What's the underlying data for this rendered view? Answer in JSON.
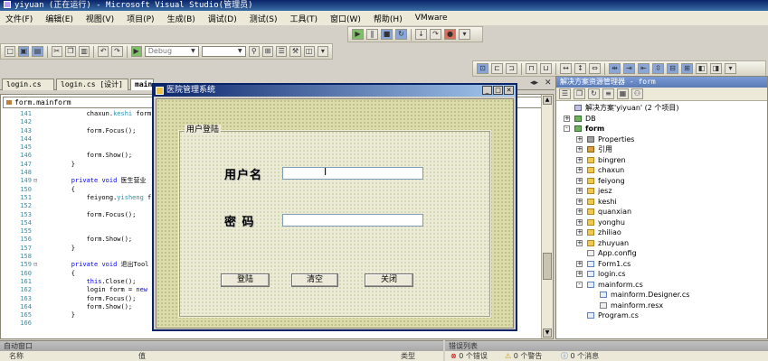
{
  "window": {
    "title": "yiyuan (正在运行) - Microsoft Visual Studio(管理员)"
  },
  "menu": [
    "文件(F)",
    "编辑(E)",
    "视图(V)",
    "项目(P)",
    "生成(B)",
    "调试(D)",
    "测试(S)",
    "工具(T)",
    "窗口(W)",
    "帮助(H)",
    "VMware"
  ],
  "toolbar": {
    "config": "Debug"
  },
  "doc_tabs": [
    {
      "label": "login.cs"
    },
    {
      "label": "login.cs [设计]"
    },
    {
      "label": "mainform.cs"
    }
  ],
  "editor": {
    "nav_combo": "form.mainform",
    "lines": [
      {
        "num": "141",
        "text": "            chaxun.keshi form",
        "kw": ""
      },
      {
        "num": "142",
        "text": "",
        "kw": ""
      },
      {
        "num": "143",
        "text": "            form.Focus();",
        "kw": ""
      },
      {
        "num": "144",
        "text": "",
        "kw": ""
      },
      {
        "num": "145",
        "text": "",
        "kw": ""
      },
      {
        "num": "146",
        "text": "            form.Show();",
        "kw": ""
      },
      {
        "num": "147",
        "text": "        }",
        "kw": ""
      },
      {
        "num": "148",
        "text": "",
        "kw": ""
      },
      {
        "num": "149",
        "text": "        private void 医生营业",
        "kw": "private void"
      },
      {
        "num": "150",
        "text": "        {",
        "kw": ""
      },
      {
        "num": "151",
        "text": "            feiyong.yisheng f",
        "kw": ""
      },
      {
        "num": "152",
        "text": "",
        "kw": ""
      },
      {
        "num": "153",
        "text": "            form.Focus();",
        "kw": ""
      },
      {
        "num": "154",
        "text": "",
        "kw": ""
      },
      {
        "num": "155",
        "text": "",
        "kw": ""
      },
      {
        "num": "156",
        "text": "            form.Show();",
        "kw": ""
      },
      {
        "num": "157",
        "text": "        }",
        "kw": ""
      },
      {
        "num": "158",
        "text": "",
        "kw": ""
      },
      {
        "num": "159",
        "text": "        private void 退出Tool",
        "kw": "private void"
      },
      {
        "num": "160",
        "text": "        {",
        "kw": ""
      },
      {
        "num": "161",
        "text": "            this.Close();",
        "kw": "this"
      },
      {
        "num": "162",
        "text": "            login form = new",
        "kw": ""
      },
      {
        "num": "163",
        "text": "            form.Focus();",
        "kw": ""
      },
      {
        "num": "164",
        "text": "            form.Show();",
        "kw": ""
      },
      {
        "num": "165",
        "text": "        }",
        "kw": ""
      },
      {
        "num": "166",
        "text": "",
        "kw": ""
      }
    ]
  },
  "login_form": {
    "title": "医院管理系统",
    "group_label": "用户登陆",
    "username_label": "用户名",
    "password_label": "密 码",
    "username_value": "",
    "password_value": "",
    "login_button": "登陆",
    "clear_button": "清空",
    "close_button": "关闭"
  },
  "solution_explorer": {
    "title": "解决方案资源管理器 - form",
    "nodes": [
      {
        "label": "解决方案'yiyuan' (2 个项目)",
        "level": 0,
        "exp": "",
        "icon": "sol"
      },
      {
        "label": "DB",
        "level": 0,
        "exp": "+",
        "icon": "proj"
      },
      {
        "label": "form",
        "level": 0,
        "exp": "-",
        "icon": "proj",
        "bold": true
      },
      {
        "label": "Properties",
        "level": 1,
        "exp": "+",
        "icon": "props"
      },
      {
        "label": "引用",
        "level": 1,
        "exp": "+",
        "icon": "ref"
      },
      {
        "label": "bingren",
        "level": 1,
        "exp": "+",
        "icon": "folder"
      },
      {
        "label": "chaxun",
        "level": 1,
        "exp": "+",
        "icon": "folder"
      },
      {
        "label": "feiyong",
        "level": 1,
        "exp": "+",
        "icon": "folder"
      },
      {
        "label": "jesz",
        "level": 1,
        "exp": "+",
        "icon": "folder"
      },
      {
        "label": "keshi",
        "level": 1,
        "exp": "+",
        "icon": "folder"
      },
      {
        "label": "quanxian",
        "level": 1,
        "exp": "+",
        "icon": "folder"
      },
      {
        "label": "yonghu",
        "level": 1,
        "exp": "+",
        "icon": "folder"
      },
      {
        "label": "zhiliao",
        "level": 1,
        "exp": "+",
        "icon": "folder"
      },
      {
        "label": "zhuyuan",
        "level": 1,
        "exp": "+",
        "icon": "folder"
      },
      {
        "label": "App.config",
        "level": 1,
        "exp": "",
        "icon": "file-cfg"
      },
      {
        "label": "Form1.cs",
        "level": 1,
        "exp": "+",
        "icon": "file-cs"
      },
      {
        "label": "login.cs",
        "level": 1,
        "exp": "+",
        "icon": "file-cs"
      },
      {
        "label": "mainform.cs",
        "level": 1,
        "exp": "-",
        "icon": "file-cs"
      },
      {
        "label": "mainform.Designer.cs",
        "level": 2,
        "exp": "",
        "icon": "file-cs"
      },
      {
        "label": "mainform.resx",
        "level": 2,
        "exp": "",
        "icon": "file-cfg"
      },
      {
        "label": "Program.cs",
        "level": 1,
        "exp": "",
        "icon": "file-cs"
      }
    ]
  },
  "bottom": {
    "autos_title": "自动窗口",
    "autos_col_name": "名称",
    "autos_col_value": "值",
    "autos_col_type": "类型",
    "errors_title": "错误列表",
    "errors_count": "0 个错误",
    "warnings_count": "0 个警告",
    "messages_count": "0 个消息"
  }
}
